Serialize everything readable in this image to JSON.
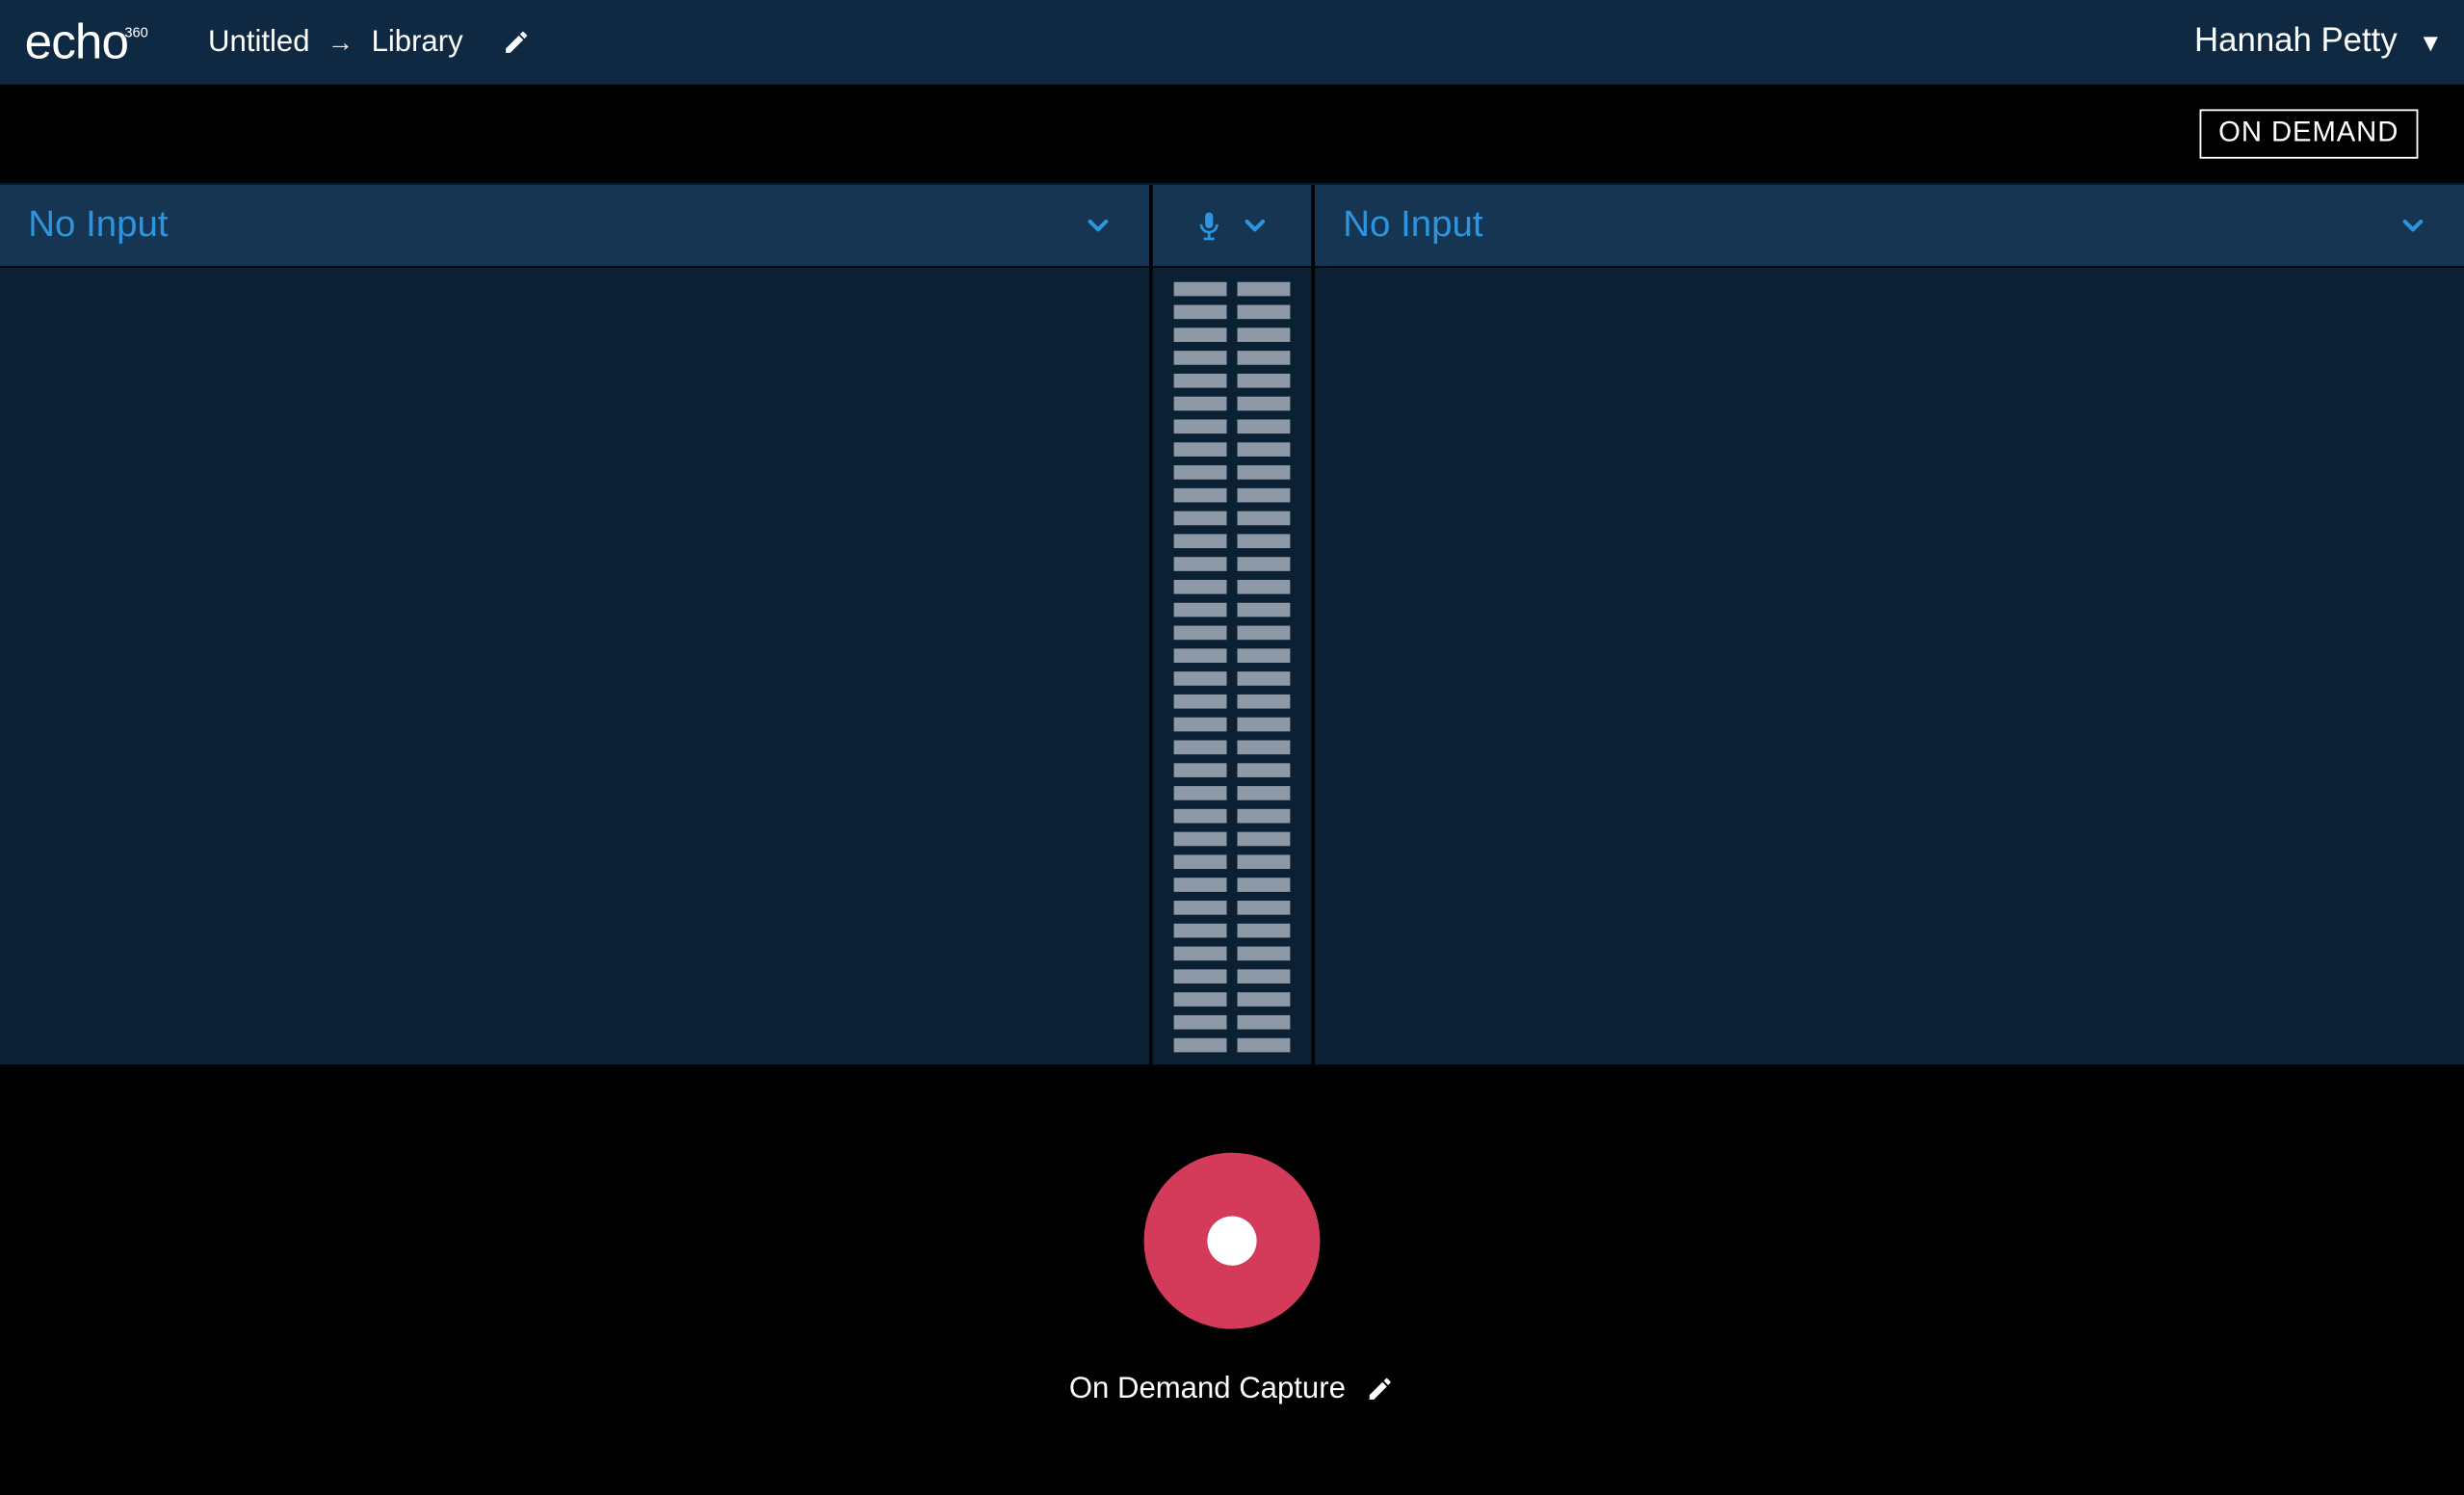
{
  "header": {
    "logo_main": "echo",
    "logo_sup": "360",
    "title": "Untitled",
    "destination": "Library",
    "user_name": "Hannah Petty"
  },
  "status": {
    "badge": "ON DEMAND"
  },
  "sources": {
    "left_label": "No Input",
    "right_label": "No Input"
  },
  "capture": {
    "label": "On Demand Capture"
  },
  "icons": {
    "pencil": "pencil-icon",
    "mic": "microphone-icon",
    "chevron_down": "chevron-down-icon",
    "caret_down": "caret-down-icon",
    "arrow_right": "arrow-right-icon"
  },
  "colors": {
    "header_bg": "#0f2942",
    "accent": "#2d95dd",
    "record": "#d43a5a",
    "panel_bg": "#0b2032"
  },
  "meter": {
    "segments_per_column": 34
  }
}
